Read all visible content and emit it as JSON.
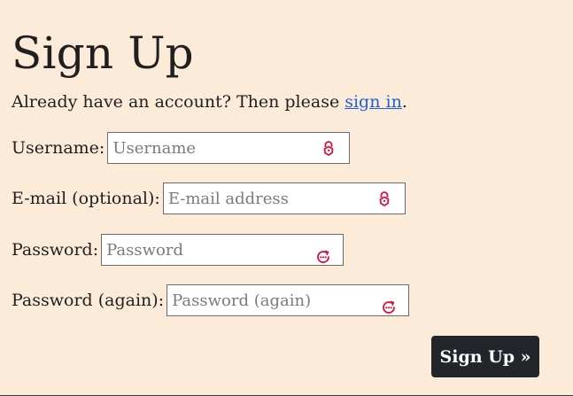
{
  "page": {
    "title": "Sign Up",
    "intro_before": "Already have an account? Then please ",
    "intro_link": "sign in",
    "intro_after": "."
  },
  "form": {
    "username": {
      "label": "Username:",
      "placeholder": "Username",
      "value": "",
      "icon": "lock-icon"
    },
    "email": {
      "label": "E-mail (optional):",
      "placeholder": "E-mail address",
      "value": "",
      "icon": "lock-icon"
    },
    "password": {
      "label": "Password:",
      "placeholder": "Password",
      "value": "",
      "icon": "password-manager-icon"
    },
    "password_again": {
      "label": "Password (again):",
      "placeholder": "Password (again)",
      "value": "",
      "icon": "password-manager-icon"
    },
    "submit_label": "Sign Up »"
  },
  "colors": {
    "background": "#fdebda",
    "link": "#1a62d6",
    "button": "#22252a",
    "icon": "#d9113a"
  }
}
